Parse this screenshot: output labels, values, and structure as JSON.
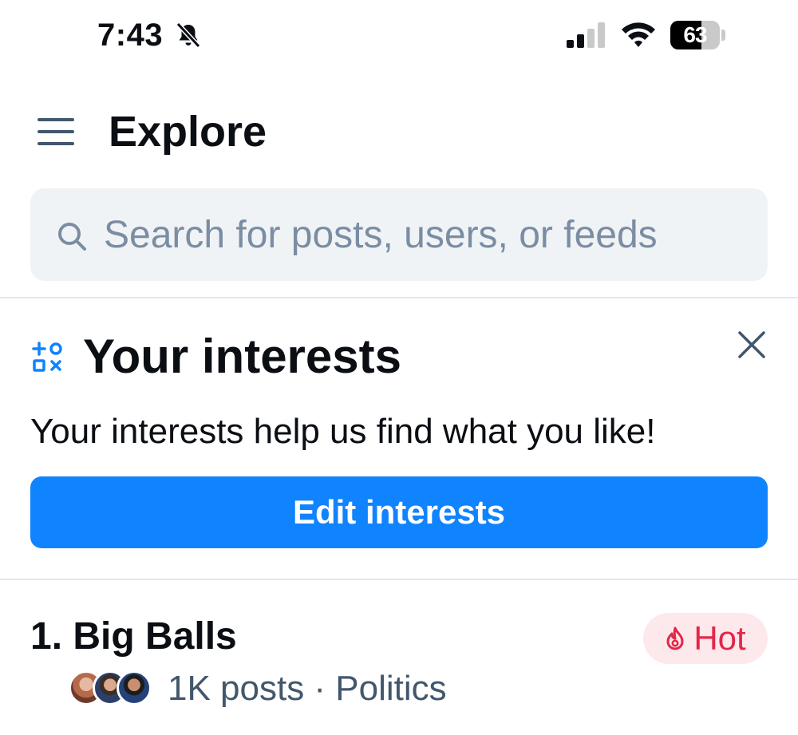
{
  "status_bar": {
    "time": "7:43",
    "battery": "63",
    "battery_level": 0.63,
    "icons": [
      "bell-muted-icon",
      "signal-icon",
      "wifi-icon",
      "battery-icon"
    ]
  },
  "header": {
    "menu_icon": "hamburger-menu-icon",
    "title": "Explore"
  },
  "search": {
    "icon": "search-icon",
    "placeholder": "Search for posts, users, or feeds",
    "value": ""
  },
  "interests": {
    "icon": "interests-shapes-icon",
    "title": "Your interests",
    "close_icon": "close-icon",
    "description": "Your interests help us find what you like!",
    "button_label": "Edit interests"
  },
  "trending": [
    {
      "title": "1. Big Balls",
      "badge": "Hot",
      "badge_icon": "fire-icon",
      "meta": "1K posts · Politics",
      "avatar_count": 3
    }
  ],
  "colors": {
    "accent": "#1083fe",
    "hot_text": "#e3264a",
    "hot_background": "#fde8ec",
    "search_background": "#f0f3f5",
    "placeholder": "#7a8da3",
    "muted_text": "#42576c"
  }
}
